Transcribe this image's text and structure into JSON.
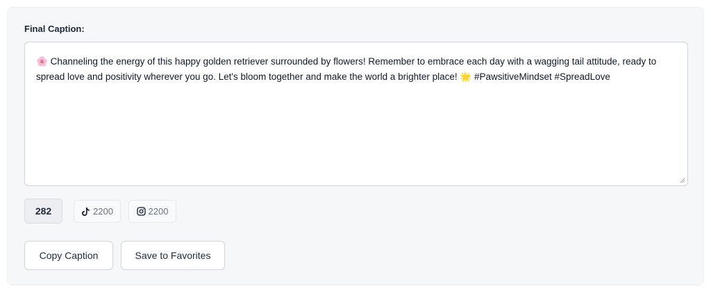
{
  "caption_panel": {
    "label": "Final Caption:",
    "text_prefix": "🌸",
    "text": " Channeling the energy of this happy golden retriever surrounded by flowers! Remember to embrace each day with a wagging tail attitude, ready to spread love and positivity wherever you go. Let's bloom together and make the world a brighter place! 🌟 #PawsitiveMindset #SpreadLove"
  },
  "counters": {
    "char_count": "282",
    "tiktok": {
      "icon": "tiktok-icon",
      "limit": "2200"
    },
    "instagram": {
      "icon": "instagram-icon",
      "limit": "2200"
    }
  },
  "actions": {
    "copy_label": "Copy Caption",
    "favorites_label": "Save to Favorites"
  }
}
